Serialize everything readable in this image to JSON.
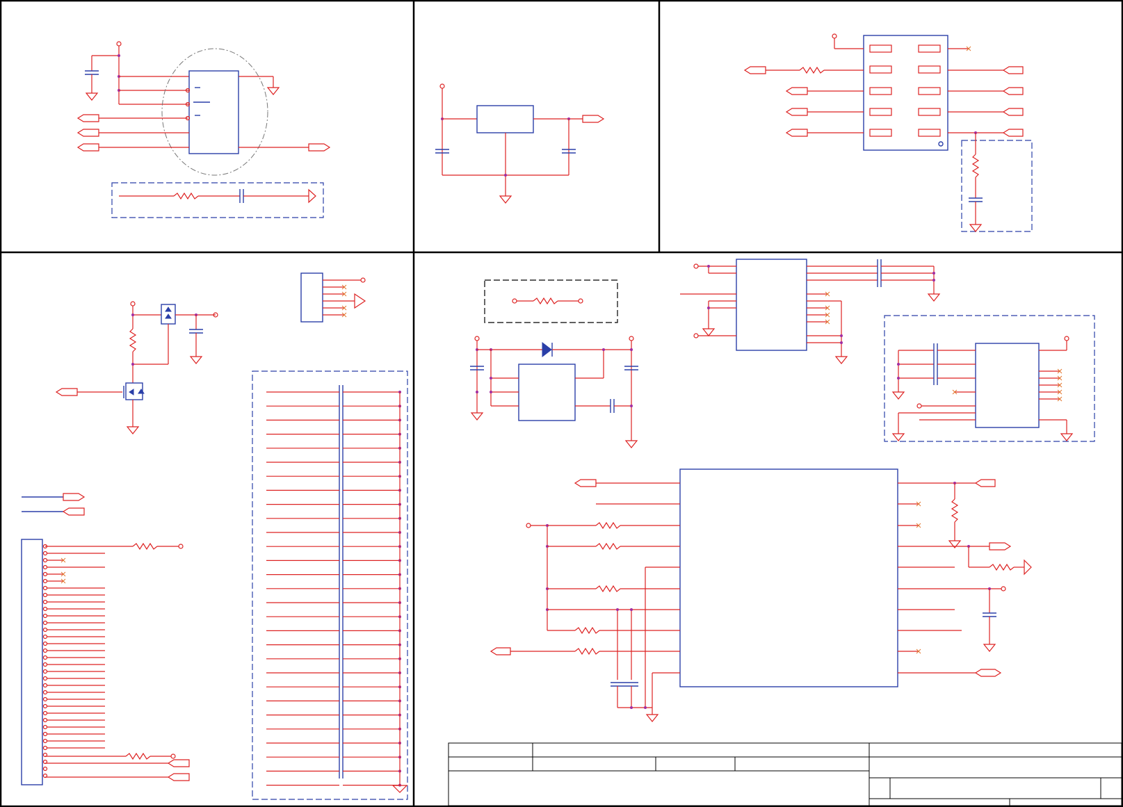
{
  "document": {
    "type": "circuit schematic sheet",
    "text_labels": []
  },
  "colors": {
    "wire": "#dd2222",
    "component": "#2a3fa8",
    "junction": "#a12ca1",
    "frame": "#000000",
    "no_connect": "#e2762e"
  },
  "panels": [
    {
      "id": "top-left",
      "name": "ic-with-highlight-region"
    },
    {
      "id": "top-middle",
      "name": "voltage-regulator"
    },
    {
      "id": "top-right",
      "name": "connector-block"
    },
    {
      "id": "bottom-left",
      "name": "power-switch-and-connectors"
    },
    {
      "id": "bottom-right",
      "name": "main-controller"
    }
  ],
  "title_block": {
    "fields": []
  }
}
